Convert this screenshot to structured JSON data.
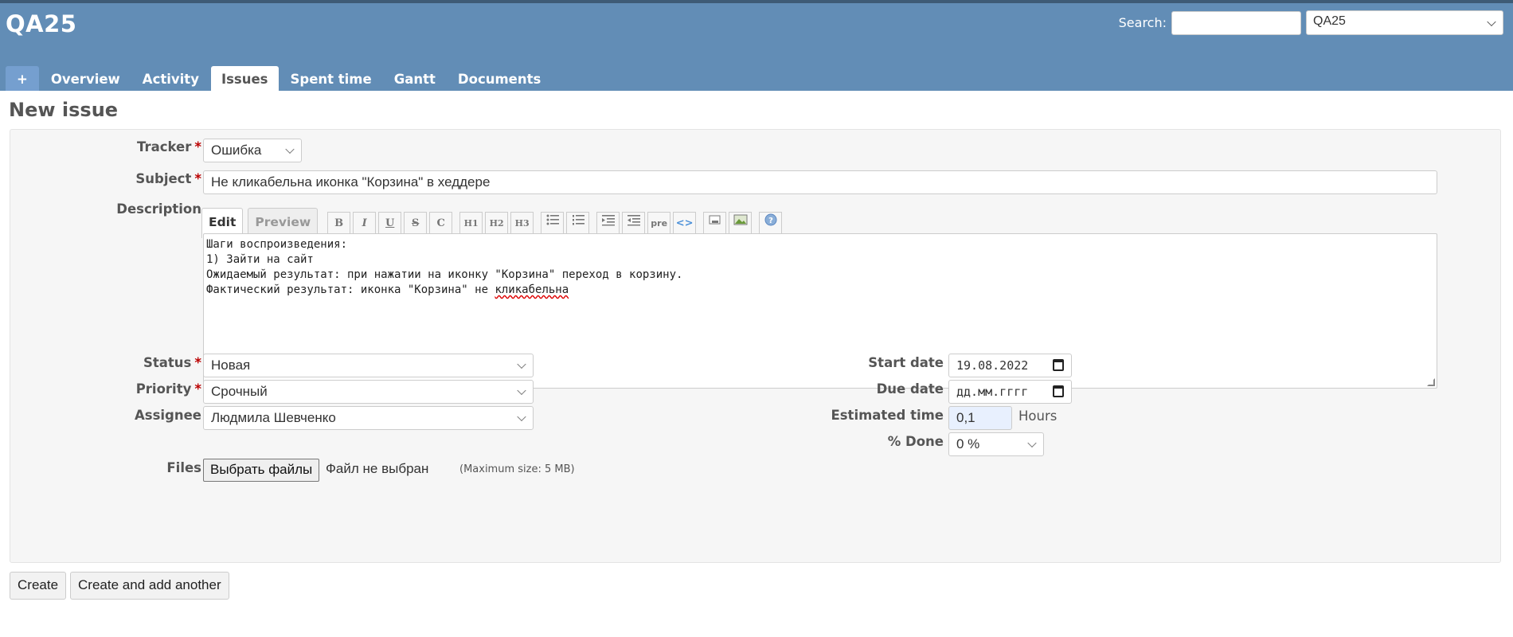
{
  "header": {
    "project_title": "QA25",
    "search_label": "Search:",
    "search_value": "",
    "project_select_value": "QA25",
    "menu": [
      {
        "label": "+"
      },
      {
        "label": "Overview"
      },
      {
        "label": "Activity"
      },
      {
        "label": "Issues"
      },
      {
        "label": "Spent time"
      },
      {
        "label": "Gantt"
      },
      {
        "label": "Documents"
      }
    ],
    "selected_tab": "Issues"
  },
  "page_title": "New issue",
  "form": {
    "tracker": {
      "label": "Tracker",
      "required_mark": "*",
      "value": "Ошибка"
    },
    "subject": {
      "label": "Subject",
      "required_mark": "*",
      "value": "Не кликабельна иконка \"Корзина\" в хеддере"
    },
    "description": {
      "label": "Description",
      "tabs": {
        "edit": "Edit",
        "preview": "Preview"
      },
      "toolbar": {
        "bold": "B",
        "italic": "I",
        "underline": "U",
        "strike": "S",
        "code": "C",
        "h1": "H1",
        "h2": "H2",
        "h3": "H3",
        "pre": "pre",
        "link": "<>"
      },
      "lines": [
        "Шаги воспроизведения:",
        "1) Зайти на сайт",
        "",
        "Ожидаемый результат: при нажатии на иконку \"Корзина\" переход в корзину.",
        "Фактический результат: иконка \"Корзина\" не "
      ],
      "last_word": "кликабельна"
    },
    "status": {
      "label": "Status",
      "required_mark": "*",
      "value": "Новая"
    },
    "priority": {
      "label": "Priority",
      "required_mark": "*",
      "value": "Срочный"
    },
    "assignee": {
      "label": "Assignee",
      "value": "Людмила Шевченко"
    },
    "start_date": {
      "label": "Start date",
      "value": "19.08.2022"
    },
    "due_date": {
      "label": "Due date",
      "value": "дд.мм.гггг"
    },
    "estimated_time": {
      "label": "Estimated time",
      "value": "0,1",
      "unit": "Hours"
    },
    "done_ratio": {
      "label": "% Done",
      "value": "0 %"
    },
    "files": {
      "label": "Files",
      "button_label": "Выбрать файлы",
      "status_text": "Файл не выбран",
      "max_size": "(Maximum size: 5 MB)"
    }
  },
  "actions": {
    "create": "Create",
    "create_and_add": "Create and add another"
  },
  "colors": {
    "header": "#628db6",
    "required": "#bb0000",
    "estimated_bg": "#e8f0fe"
  }
}
